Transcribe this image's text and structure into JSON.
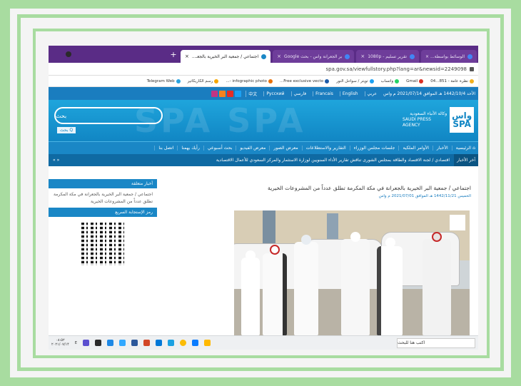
{
  "browser": {
    "tabs": [
      {
        "label": "الوسائط بواسطة... ×"
      },
      {
        "label": "تقرير تسليم - 1080p"
      },
      {
        "label": "بر الجعرانة واس - بحث Google"
      },
      {
        "label": "اجتماعي / جمعية البر الخيرية بالجعـ..."
      }
    ],
    "new_tab": "+",
    "url": "spa.gov.sa/viewfullstory.php?lang=ar&newsid=2249098",
    "bookmarks": [
      "نظرة عامة - 851...04",
      "Gmail",
      "واتساب",
      "تويتر / سواحل النور",
      "Free exclusive vecto...",
      "infographic photo -...",
      "رسم الكاريكاتير",
      "Telegram Web"
    ]
  },
  "site": {
    "date": "الأحد 1442/10/4 هـ الموافق 2021/07/14 م واس",
    "languages": [
      "عربي",
      "English",
      "Francais",
      "فارسي",
      "Pусский",
      "中文"
    ],
    "logo_mark": "واس SPA",
    "logo_text_ar": "وكالة الأنباء السعودية",
    "logo_text_en": "SAUDI PRESS AGENCY",
    "search_placeholder": "بحث",
    "search_button": "Q بحث",
    "nav": [
      "الرئيسية",
      "الأخبار",
      "الأوامر الملكية",
      "جلسات مجلس الوزراء",
      "التقارير والاستطلاعات",
      "معرض الصور",
      "معرض الفيديو",
      "بحث أسبوعي",
      "رأيك يهمنا",
      "اتصل بنا"
    ],
    "ticker_label": "آخر الأخبار",
    "ticker_text": "اقتصادي / لجنة الاقتصاد والطاقة بمجلس الشورى تناقش تقارير الأداء السنويين لوزارة الاستثمار والمركز السعودي للأعمال الاقتصادية",
    "ticker_arrows": "« »"
  },
  "article": {
    "title": "اجتماعي / جمعية البر الخيرية بالجعرانة في مكة المكرمة تطلق عدداً من المشروعات الخيرية",
    "meta": "الخميس 1442/11/21 هـ الموافق 2021/07/01 م واس"
  },
  "sidebar": {
    "related_head": "أخبار متعلقة",
    "related_text": "اجتماعي / جمعية البر الخيرية بالجعرانة في مكة المكرمة تطلق عدداً من المشروعات الخيرية",
    "qr_head": "رمز الإستجابة السريع"
  },
  "taskbar": {
    "time": "۰۸:۵۲",
    "date": "۲۰۲۱/۰۷/۱۴",
    "lang": "E",
    "search": "اكتب هنا للبحث"
  },
  "colors": {
    "frame": "#a8dca0",
    "tabbar": "#5a2c86",
    "site_blue": "#1a87c6"
  }
}
